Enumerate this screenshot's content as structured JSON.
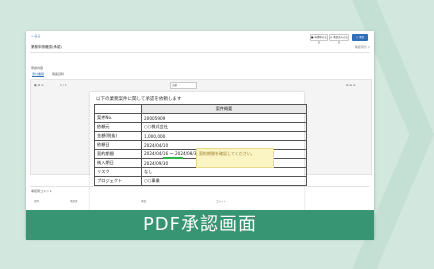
{
  "toolbar": {
    "back_label": "< 戻る",
    "btn1_label": "■ 申請中のもの",
    "btn2_label": "◎ 承認済みのもの",
    "btn3_label": "○ 承認"
  },
  "page": {
    "title": "業務申請確認(承認)",
    "badge": "承認待ち ▽"
  },
  "section": {
    "label": "申請内容"
  },
  "tabs": [
    {
      "label": "添付書類"
    },
    {
      "label": "関連資料"
    }
  ],
  "viewer": {
    "page_indicator": "1 / 1",
    "zoom_value": "自動",
    "tools_left": "▣ ⊕ ⊖",
    "tools_right": "⊕ ⊟ ≡"
  },
  "pdf": {
    "heading": "以下の業務案件に関して承認を依頼します",
    "header": "案件概要",
    "rows": [
      {
        "label": "案件No.",
        "value": "20005909"
      },
      {
        "label": "依頼元",
        "value": "○○株式会社"
      },
      {
        "label": "金額(税抜)",
        "value": "1,000,000"
      },
      {
        "label": "依頼日",
        "value": "2024/04/10"
      },
      {
        "label": "契約期間",
        "value": "2024/04/16 ～ 2024/08/30"
      },
      {
        "label": "納入期日",
        "value": "2024/09/30"
      },
      {
        "label": "リスク",
        "value": "なし"
      },
      {
        "label": "プロジェクト",
        "value": "○○事業"
      }
    ]
  },
  "annotation": {
    "text": "契約期間を確認してください。"
  },
  "comments": {
    "title": "承認者コメント",
    "columns": [
      "日時",
      "承認者",
      "承認",
      "コメント"
    ]
  },
  "banner": {
    "text": "PDF承認画面"
  }
}
